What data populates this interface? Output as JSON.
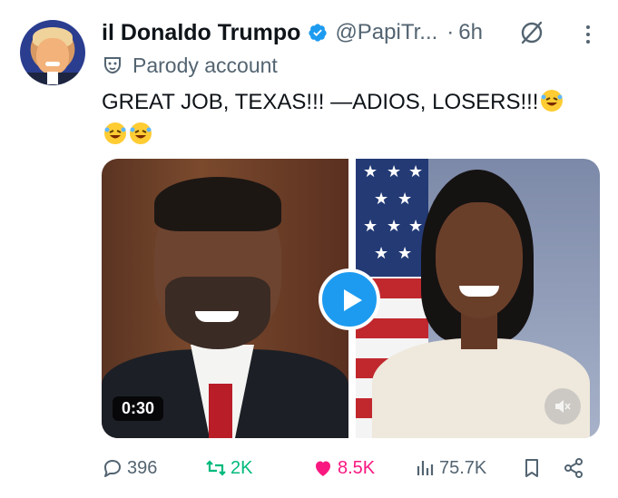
{
  "author": {
    "name": "il Donaldo Trumpo",
    "handle": "@PapiTr...",
    "separator": "·",
    "time": "6h",
    "label": "Parody account"
  },
  "tweet": {
    "text": "GREAT JOB, TEXAS!!! —ADIOS, LOSERS!!!",
    "emoji_count_trailing": 3
  },
  "media": {
    "duration": "0:30",
    "play_icon": "play-icon",
    "mute_icon": "volume-muted-icon"
  },
  "actions": {
    "replies": "396",
    "reposts": "2K",
    "likes": "8.5K",
    "views": "75.7K"
  },
  "colors": {
    "accent": "#1d9bf0",
    "repost": "#00ba7c",
    "like": "#f91880",
    "muted_text": "#536471",
    "text": "#0f1419"
  }
}
